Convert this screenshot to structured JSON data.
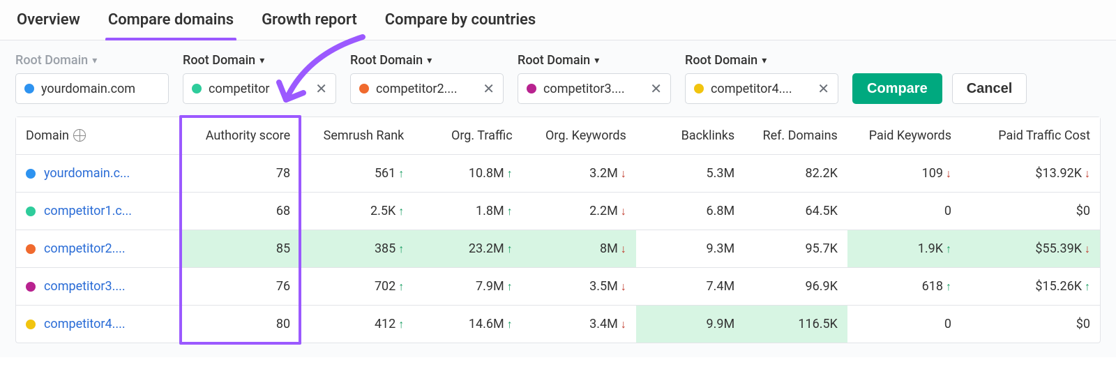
{
  "tabs": [
    "Overview",
    "Compare domains",
    "Growth report",
    "Compare by countries"
  ],
  "active_tab": 1,
  "filters": {
    "root_label": "Root Domain",
    "domains": [
      {
        "label": "yourdomain.com",
        "color": "#2e93f0",
        "removable": false,
        "muted": true
      },
      {
        "label": "competitor",
        "color": "#2ecc9b",
        "removable": true,
        "muted": false
      },
      {
        "label": "competitor2....",
        "color": "#f06a2e",
        "removable": true,
        "muted": false
      },
      {
        "label": "competitor3....",
        "color": "#b8228f",
        "removable": true,
        "muted": false
      },
      {
        "label": "competitor4....",
        "color": "#f1c40f",
        "removable": true,
        "muted": false
      }
    ],
    "compare_btn": "Compare",
    "cancel_btn": "Cancel"
  },
  "table": {
    "headers": [
      "Domain",
      "Authority score",
      "Semrush Rank",
      "Org. Traffic",
      "Org. Keywords",
      "Backlinks",
      "Ref. Domains",
      "Paid Keywords",
      "Paid Traffic Cost"
    ],
    "rows": [
      {
        "color": "#2e93f0",
        "domain": "yourdomain.c...",
        "authority": "78",
        "rank": "561",
        "rank_dir": "up",
        "traffic": "10.8M",
        "traffic_dir": "up",
        "org_kw": "3.2M",
        "org_kw_dir": "down",
        "backlinks": "5.3M",
        "ref_domains": "82.2K",
        "paid_kw": "109",
        "paid_kw_dir": "down",
        "paid_cost": "$13.92K",
        "paid_cost_dir": "down",
        "best": []
      },
      {
        "color": "#2ecc9b",
        "domain": "competitor1.c...",
        "authority": "68",
        "rank": "2.5K",
        "rank_dir": "up",
        "traffic": "1.8M",
        "traffic_dir": "up",
        "org_kw": "2.2M",
        "org_kw_dir": "down",
        "backlinks": "6.8M",
        "ref_domains": "64.5K",
        "paid_kw": "0",
        "paid_kw_dir": "",
        "paid_cost": "$0",
        "paid_cost_dir": "",
        "best": []
      },
      {
        "color": "#f06a2e",
        "domain": "competitor2....",
        "authority": "85",
        "rank": "385",
        "rank_dir": "up",
        "traffic": "23.2M",
        "traffic_dir": "up",
        "org_kw": "8M",
        "org_kw_dir": "down",
        "backlinks": "9.3M",
        "ref_domains": "95.7K",
        "paid_kw": "1.9K",
        "paid_kw_dir": "up",
        "paid_cost": "$55.39K",
        "paid_cost_dir": "down",
        "best": [
          "authority",
          "rank",
          "traffic",
          "org_kw",
          "paid_kw",
          "paid_cost"
        ]
      },
      {
        "color": "#b8228f",
        "domain": "competitor3....",
        "authority": "76",
        "rank": "702",
        "rank_dir": "up",
        "traffic": "7.9M",
        "traffic_dir": "up",
        "org_kw": "3.5M",
        "org_kw_dir": "down",
        "backlinks": "7.4M",
        "ref_domains": "96.9K",
        "paid_kw": "618",
        "paid_kw_dir": "up",
        "paid_cost": "$15.26K",
        "paid_cost_dir": "up",
        "best": []
      },
      {
        "color": "#f1c40f",
        "domain": "competitor4....",
        "authority": "80",
        "rank": "412",
        "rank_dir": "up",
        "traffic": "14.6M",
        "traffic_dir": "up",
        "org_kw": "3.4M",
        "org_kw_dir": "down",
        "backlinks": "9.9M",
        "ref_domains": "116.5K",
        "paid_kw": "0",
        "paid_kw_dir": "",
        "paid_cost": "$0",
        "paid_cost_dir": "",
        "best": [
          "backlinks",
          "ref_domains"
        ]
      }
    ]
  }
}
